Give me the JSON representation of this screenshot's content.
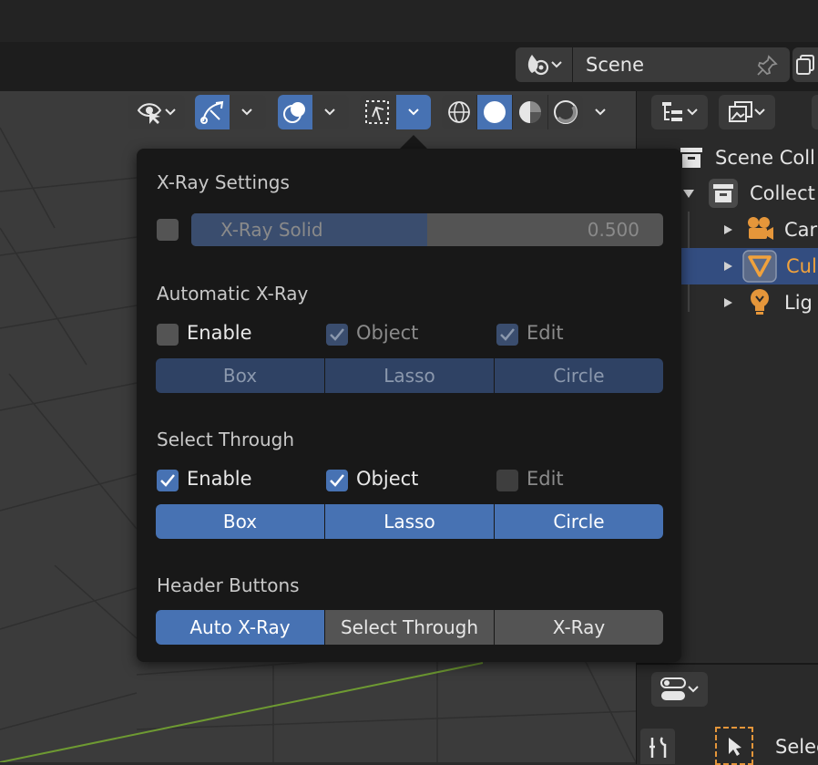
{
  "scene": {
    "name": "Scene"
  },
  "popup": {
    "xray_settings": {
      "title": "X-Ray Settings",
      "slider_label": "X-Ray Solid",
      "slider_value": "0.500",
      "fill_fraction": 0.5
    },
    "automatic_xray": {
      "title": "Automatic X-Ray",
      "options": [
        {
          "label": "Enable",
          "checked": false
        },
        {
          "label": "Object",
          "checked": true
        },
        {
          "label": "Edit",
          "checked": true
        }
      ],
      "modes": [
        "Box",
        "Lasso",
        "Circle"
      ]
    },
    "select_through": {
      "title": "Select Through",
      "options": [
        {
          "label": "Enable",
          "checked": true
        },
        {
          "label": "Object",
          "checked": true
        },
        {
          "label": "Edit",
          "checked": false
        }
      ],
      "modes": [
        "Box",
        "Lasso",
        "Circle"
      ]
    },
    "header_buttons": {
      "title": "Header Buttons",
      "buttons": [
        "Auto X-Ray",
        "Select Through",
        "X-Ray"
      ]
    }
  },
  "outliner": {
    "items": [
      {
        "label": "Scene Coll"
      },
      {
        "label": "Collect"
      },
      {
        "label": "Car"
      },
      {
        "label": "Cul"
      },
      {
        "label": "Lig"
      }
    ]
  },
  "properties": {
    "tool_label": "Selec"
  },
  "colors": {
    "accent": "#4772b3",
    "popup_bg": "#181818",
    "selected_text": "#f1a23c"
  }
}
